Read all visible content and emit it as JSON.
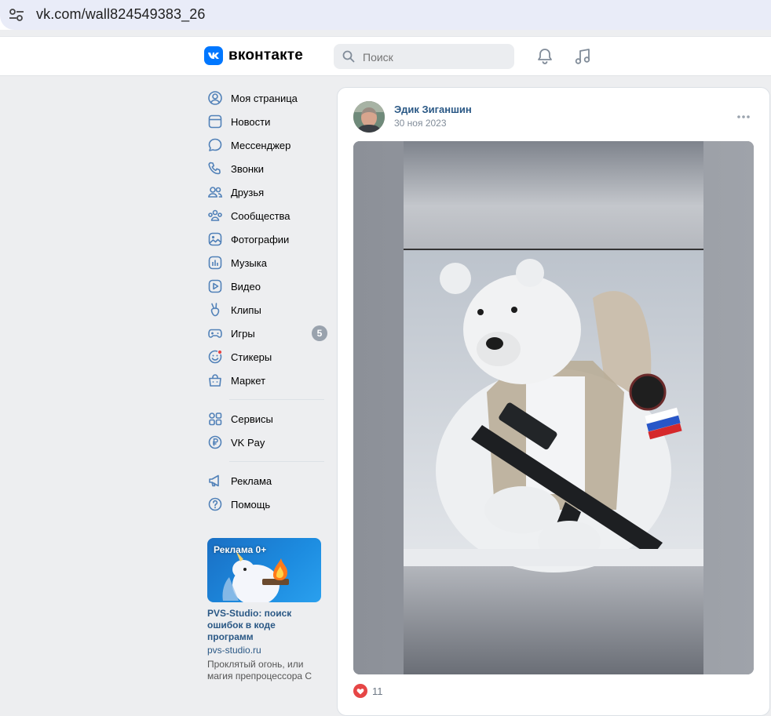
{
  "browser": {
    "url": "vk.com/wall824549383_26"
  },
  "header": {
    "logo_mark": "VK",
    "logo_text": "вконтакте",
    "search_placeholder": "Поиск",
    "accent": "#0077ff"
  },
  "sidebar": {
    "items": [
      {
        "label": "Моя страница",
        "icon": "user-circle-icon"
      },
      {
        "label": "Новости",
        "icon": "news-icon"
      },
      {
        "label": "Мессенджер",
        "icon": "message-icon"
      },
      {
        "label": "Звонки",
        "icon": "phone-icon"
      },
      {
        "label": "Друзья",
        "icon": "friends-icon"
      },
      {
        "label": "Сообщества",
        "icon": "communities-icon"
      },
      {
        "label": "Фотографии",
        "icon": "photos-icon"
      },
      {
        "label": "Музыка",
        "icon": "music-icon"
      },
      {
        "label": "Видео",
        "icon": "video-icon"
      },
      {
        "label": "Клипы",
        "icon": "clips-icon"
      },
      {
        "label": "Игры",
        "icon": "games-icon",
        "badge": "5"
      },
      {
        "label": "Стикеры",
        "icon": "stickers-icon"
      },
      {
        "label": "Маркет",
        "icon": "market-icon"
      }
    ],
    "items2": [
      {
        "label": "Сервисы",
        "icon": "services-icon"
      },
      {
        "label": "VK Pay",
        "icon": "vkpay-icon"
      }
    ],
    "items3": [
      {
        "label": "Реклама",
        "icon": "megaphone-icon"
      },
      {
        "label": "Помощь",
        "icon": "help-icon"
      }
    ]
  },
  "ad": {
    "badge": "Реклама 0+",
    "title": "PVS-Studio: поиск ошибок в коде программ",
    "domain": "pvs-studio.ru",
    "description": "Проклятый огонь, или магия препроцессора С"
  },
  "post": {
    "author": "Эдик Зиганшин",
    "date": "30 ноя 2023",
    "likes": "11"
  }
}
